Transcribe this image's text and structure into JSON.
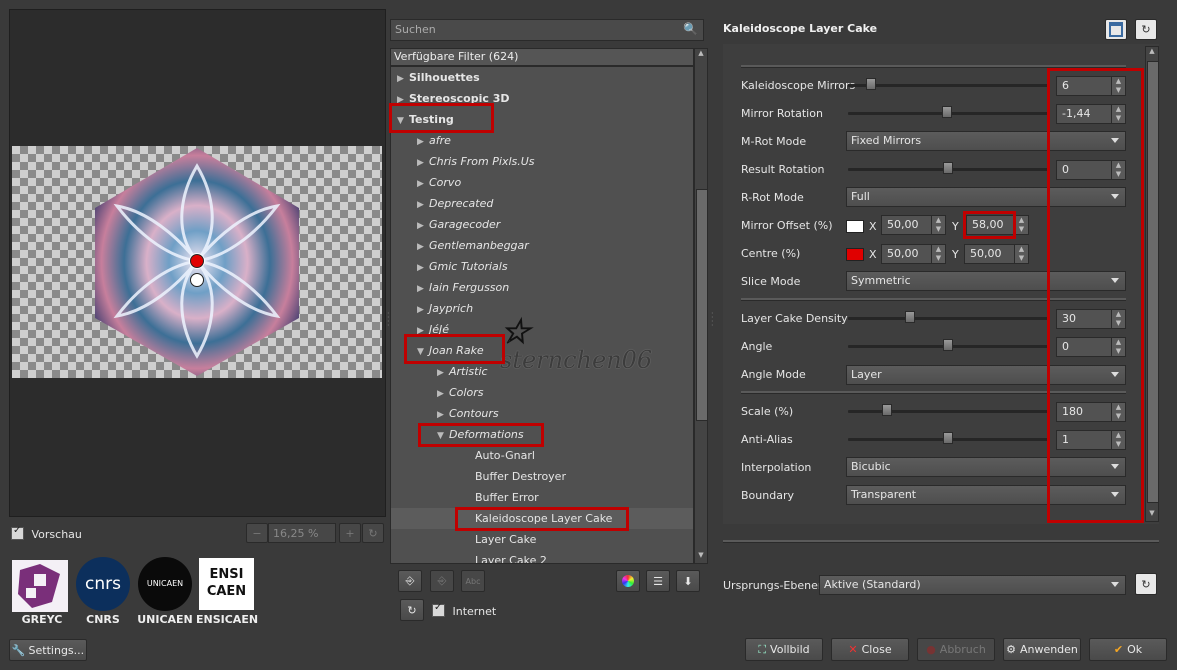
{
  "preview": {
    "checkbox_label": "Vorschau",
    "zoom_value": "16,25 %",
    "settings_label": "Settings..."
  },
  "logos": [
    {
      "name": "GREYC",
      "glyph": "G"
    },
    {
      "name": "CNRS",
      "glyph": "cnrs"
    },
    {
      "name": "UNICAEN",
      "glyph": "UNICAEN"
    },
    {
      "name": "ENSICAEN",
      "glyph": "ENSI CAEN"
    }
  ],
  "search": {
    "placeholder": "Suchen"
  },
  "tree": {
    "header": "Verfügbare Filter (624)",
    "items": [
      {
        "label": "Silhouettes"
      },
      {
        "label": "Stereoscopic 3D"
      },
      {
        "label": "Testing"
      },
      {
        "label": "afre"
      },
      {
        "label": "Chris From Pixls.Us"
      },
      {
        "label": "Corvo"
      },
      {
        "label": "Deprecated"
      },
      {
        "label": "Garagecoder"
      },
      {
        "label": "Gentlemanbeggar"
      },
      {
        "label": "Gmic Tutorials"
      },
      {
        "label": "Iain Fergusson"
      },
      {
        "label": "Jayprich"
      },
      {
        "label": "JéJé"
      },
      {
        "label": "Joan Rake"
      },
      {
        "label": "Artistic"
      },
      {
        "label": "Colors"
      },
      {
        "label": "Contours"
      },
      {
        "label": "Deformations"
      },
      {
        "label": "Auto-Gnarl"
      },
      {
        "label": "Buffer Destroyer"
      },
      {
        "label": "Buffer Error"
      },
      {
        "label": "Kaleidoscope Layer Cake"
      },
      {
        "label": "Layer Cake"
      },
      {
        "label": "Layer Cake 2"
      }
    ],
    "internet_label": "Internet"
  },
  "watermark": "sternchen06",
  "filter": {
    "title": "Kaleidoscope Layer Cake",
    "params": {
      "kaleidoscope_mirrors": {
        "label": "Kaleidoscope Mirrors",
        "value": "6"
      },
      "mirror_rotation": {
        "label": "Mirror Rotation",
        "value": "-1,44"
      },
      "mrot_mode": {
        "label": "M-Rot Mode",
        "value": "Fixed Mirrors"
      },
      "result_rotation": {
        "label": "Result Rotation",
        "value": "0"
      },
      "rrot_mode": {
        "label": "R-Rot Mode",
        "value": "Full"
      },
      "mirror_offset": {
        "label": "Mirror Offset (%)",
        "x_label": "X",
        "x": "50,00",
        "y_label": "Y",
        "y": "58,00",
        "color": "#ffffff"
      },
      "centre": {
        "label": "Centre (%)",
        "x_label": "X",
        "x": "50,00",
        "y_label": "Y",
        "y": "50,00",
        "color": "#e00000"
      },
      "slice_mode": {
        "label": "Slice Mode",
        "value": "Symmetric"
      },
      "layer_cake_density": {
        "label": "Layer Cake Density",
        "value": "30"
      },
      "angle": {
        "label": "Angle",
        "value": "0"
      },
      "angle_mode": {
        "label": "Angle Mode",
        "value": "Layer"
      },
      "scale": {
        "label": "Scale (%)",
        "value": "180"
      },
      "anti_alias": {
        "label": "Anti-Alias",
        "value": "1"
      },
      "interpolation": {
        "label": "Interpolation",
        "value": "Bicubic"
      },
      "boundary": {
        "label": "Boundary",
        "value": "Transparent"
      }
    }
  },
  "input_layers": {
    "label": "Ursprungs-Ebenen",
    "value": "Aktive (Standard)"
  },
  "buttons": {
    "fullscreen": "Vollbild",
    "close": "Close",
    "cancel": "Abbruch",
    "apply": "Anwenden",
    "ok": "Ok"
  },
  "colors": {
    "highlight": "#c00000"
  }
}
